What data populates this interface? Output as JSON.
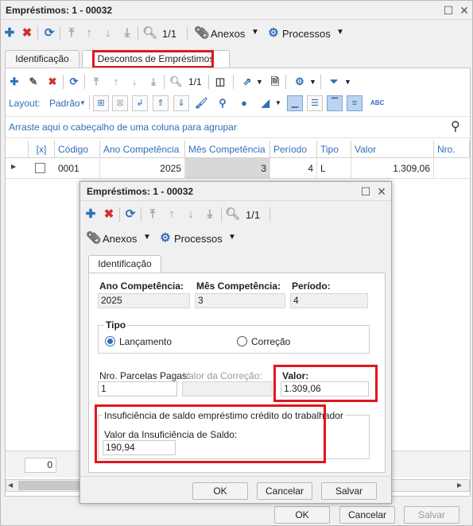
{
  "main_window": {
    "title": "Empréstimos: 1 - 00032",
    "pager": "1/1",
    "annexes_label": "Anexos",
    "processes_label": "Processos",
    "tabs": [
      {
        "label": "Identificação"
      },
      {
        "label": "Descontos de Empréstimos"
      }
    ],
    "sub_pager": "1/1",
    "layout_label": "Layout:",
    "layout_value": "Padrão",
    "group_hint": "Arraste aqui o cabeçalho de uma coluna para agrupar",
    "grid": {
      "columns": [
        "[x]",
        "Código",
        "Ano Competência",
        "Mês Competência",
        "Período",
        "Tipo",
        "Valor",
        "Nro. Pa"
      ],
      "rows": [
        {
          "codigo": "0001",
          "ano": "2025",
          "mes": "3",
          "periodo": "4",
          "tipo": "L",
          "valor": "1.309,06"
        }
      ]
    },
    "footer_count": "0",
    "buttons": {
      "ok": "OK",
      "cancel": "Cancelar",
      "save": "Salvar"
    }
  },
  "dialog": {
    "title": "Empréstimos: 1 - 00032",
    "pager": "1/1",
    "annexes_label": "Anexos",
    "processes_label": "Processos",
    "tab": "Identificação",
    "fields": {
      "ano_label": "Ano Competência:",
      "ano_value": "2025",
      "mes_label": "Mês Competência:",
      "mes_value": "3",
      "periodo_label": "Período:",
      "periodo_value": "4",
      "tipo_label": "Tipo",
      "tipo_option_1": "Lançamento",
      "tipo_option_2": "Correção",
      "parcelas_label": "Nro. Parcelas Pagas:",
      "parcelas_value": "1",
      "correcao_label": "Valor da Correção:",
      "correcao_value": "",
      "valor_label": "Valor:",
      "valor_value": "1.309,06",
      "insuf_group_label": "Insuficiência de saldo empréstimo crédito do trabalhador",
      "insuf_label": "Valor da Insuficiência de Saldo:",
      "insuf_value": "190,94"
    },
    "buttons": {
      "ok": "OK",
      "cancel": "Cancelar",
      "save": "Salvar"
    }
  },
  "colors": {
    "accent": "#2f6fb8",
    "delete": "#d0312d",
    "highlight": "#e0171c"
  }
}
